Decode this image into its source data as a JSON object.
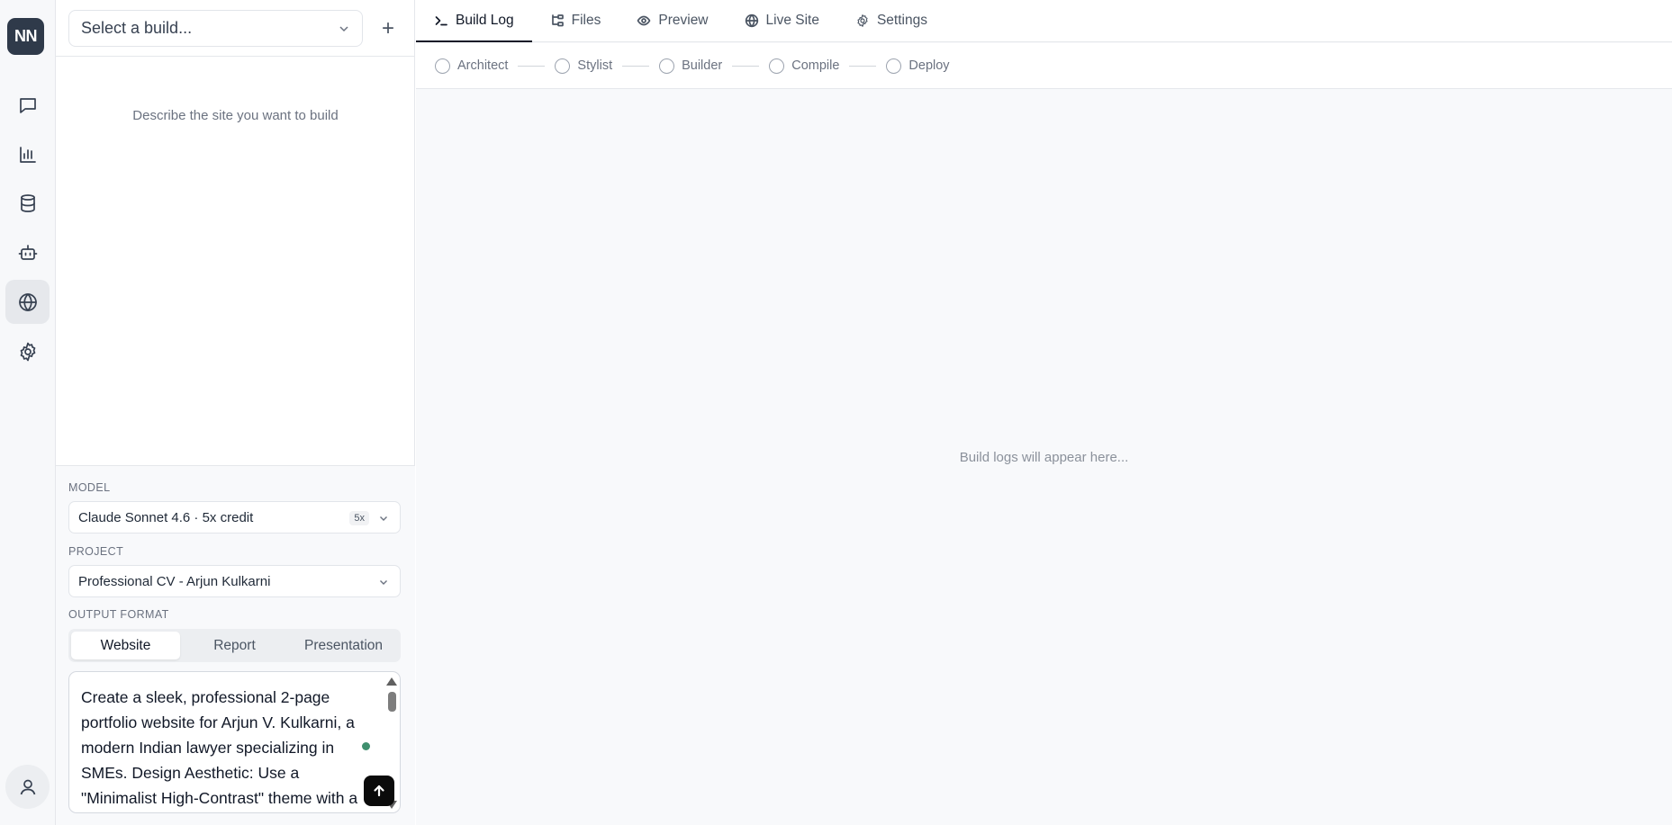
{
  "rail": {
    "logo": "NN",
    "items": [
      {
        "name": "chat",
        "icon": "message-square-icon"
      },
      {
        "name": "analytics",
        "icon": "bar-chart-icon"
      },
      {
        "name": "database",
        "icon": "database-icon"
      },
      {
        "name": "agents",
        "icon": "bot-icon"
      },
      {
        "name": "sites",
        "icon": "globe-icon",
        "active": true
      },
      {
        "name": "settings",
        "icon": "gear-icon"
      }
    ],
    "user_icon": "user-icon"
  },
  "sidebar": {
    "build_select_placeholder": "Select a build...",
    "add_label": "+",
    "empty_message": "Describe the site you want to build",
    "model": {
      "label": "MODEL",
      "value": "Claude Sonnet 4.6 · 5x credit",
      "badge": "5x"
    },
    "project": {
      "label": "PROJECT",
      "value": "Professional CV - Arjun Kulkarni"
    },
    "output_format": {
      "label": "OUTPUT FORMAT",
      "options": [
        "Website",
        "Report",
        "Presentation"
      ],
      "selected": "Website"
    },
    "prompt": {
      "lines": [
        "Create a sleek, professional 2-page",
        "portfolio website for Arjun V. Kulkarni, a",
        "modern Indian lawyer specializing in",
        "SMEs. Design Aesthetic: Use a",
        "\"Minimalist High-Contrast\" theme with a"
      ]
    }
  },
  "main": {
    "tabs": [
      {
        "label": "Build Log",
        "icon": "terminal-icon",
        "active": true
      },
      {
        "label": "Files",
        "icon": "folder-tree-icon"
      },
      {
        "label": "Preview",
        "icon": "eye-icon"
      },
      {
        "label": "Live Site",
        "icon": "globe-icon"
      },
      {
        "label": "Settings",
        "icon": "gear-icon"
      }
    ],
    "steps": [
      "Architect",
      "Stylist",
      "Builder",
      "Compile",
      "Deploy"
    ],
    "placeholder": "Build logs will appear here..."
  },
  "colors": {
    "logo_bg": "#2f3a4a",
    "status_dot": "#3f8f6e",
    "send_button": "#0b0b0b",
    "active_tab_underline": "#111827"
  }
}
